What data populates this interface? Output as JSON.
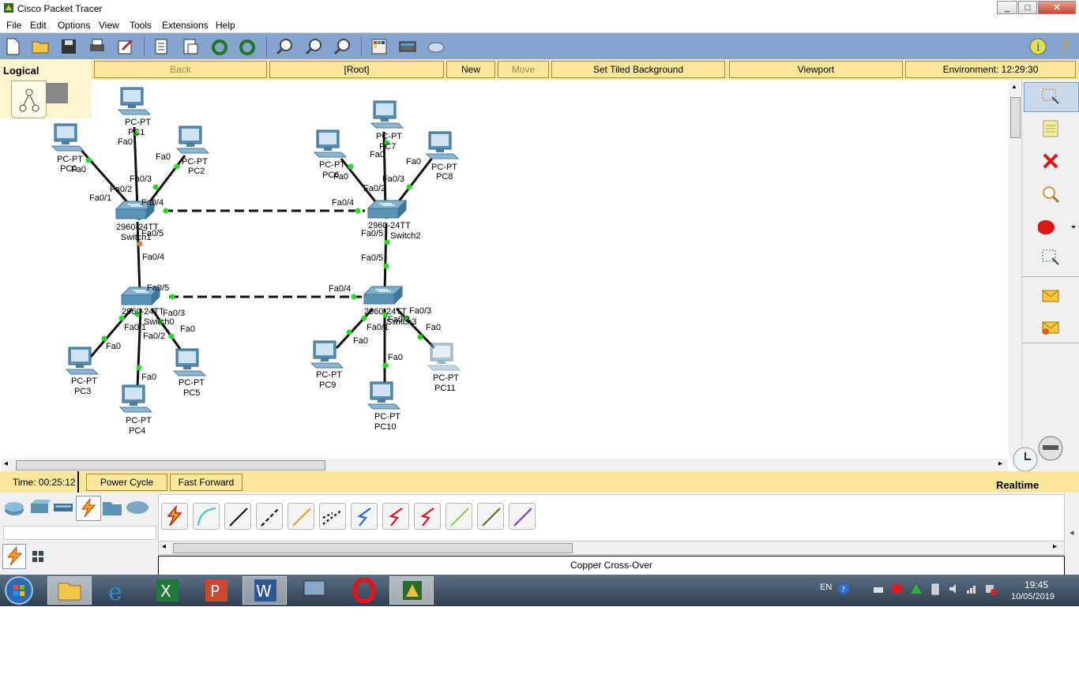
{
  "app": {
    "title": "Cisco Packet Tracer"
  },
  "menu": [
    "File",
    "Edit",
    "Options",
    "View",
    "Tools",
    "Extensions",
    "Help"
  ],
  "toolbar_icons": [
    "new-file-icon",
    "open-folder-icon",
    "save-icon",
    "print-icon",
    "activity-wizard-icon",
    "copy-icon",
    "paste-icon",
    "undo-icon",
    "redo-icon",
    "zoom-in-icon",
    "zoom-reset-icon",
    "zoom-out-icon",
    "palette-icon",
    "device-custom-icon",
    "cluster-icon",
    "info-icon",
    "help-icon"
  ],
  "nav": {
    "logical": "Logical",
    "back": "Back",
    "root": "[Root]",
    "new_cluster": "New Cluster",
    "move_object": "Move Object",
    "set_tiled_background": "Set Tiled Background",
    "viewport": "Viewport",
    "environment": "Environment: 12:29:30"
  },
  "topology": {
    "devices": [
      {
        "id": "pc1",
        "type": "PC-PT",
        "labels": [
          "PC-PT",
          "PC1"
        ]
      },
      {
        "id": "pc0",
        "type": "PC-PT",
        "labels": [
          "PC-PT",
          "PC0"
        ]
      },
      {
        "id": "pc2",
        "type": "PC-PT",
        "labels": [
          "PC-PT",
          "PC2"
        ]
      },
      {
        "id": "pc7",
        "type": "PC-PT",
        "labels": [
          "PC-PT",
          "PC7"
        ]
      },
      {
        "id": "pc6",
        "type": "PC-PT",
        "labels": [
          "PC-PT",
          "PC6"
        ]
      },
      {
        "id": "pc8",
        "type": "PC-PT",
        "labels": [
          "PC-PT",
          "PC8"
        ]
      },
      {
        "id": "sw1",
        "type": "switch",
        "labels": [
          "2960-24TT",
          "Switch1"
        ]
      },
      {
        "id": "sw2",
        "type": "switch",
        "labels": [
          "2960-24TT",
          "Switch2"
        ]
      },
      {
        "id": "sw0",
        "type": "switch",
        "labels": [
          "2960-24TT",
          "Switch0"
        ]
      },
      {
        "id": "sw3",
        "type": "switch",
        "labels": [
          "2960-24TT",
          "Switch3"
        ]
      },
      {
        "id": "pc3",
        "type": "PC-PT",
        "labels": [
          "PC-PT",
          "PC3"
        ]
      },
      {
        "id": "pc4",
        "type": "PC-PT",
        "labels": [
          "PC-PT",
          "PC4"
        ]
      },
      {
        "id": "pc5",
        "type": "PC-PT",
        "labels": [
          "PC-PT",
          "PC5"
        ]
      },
      {
        "id": "pc9",
        "type": "PC-PT",
        "labels": [
          "PC-PT",
          "PC9"
        ]
      },
      {
        "id": "pc10",
        "type": "PC-PT",
        "labels": [
          "PC-PT",
          "PC10"
        ]
      },
      {
        "id": "pc11",
        "type": "PC-PT",
        "labels": [
          "PC-PT",
          "PC11"
        ]
      }
    ],
    "port_labels": [
      "Fa0",
      "Fa0/3",
      "Fa0/2",
      "Fa0/1",
      "Fa0/4",
      "Fa0/5"
    ]
  },
  "right_tools": [
    "select-icon",
    "note-icon",
    "delete-icon",
    "inspect-icon",
    "draw-ellipse-icon",
    "resize-icon",
    "add-simple-pdu-icon",
    "add-complex-pdu-icon"
  ],
  "status": {
    "time": "Time: 00:25:12",
    "power_cycle": "Power Cycle Devices",
    "fast_forward": "Fast Forward Time",
    "mode": "Realtime"
  },
  "device_categories": [
    "routers-icon",
    "switches-icon",
    "hubs-icon",
    "connections-icon",
    "end-devices-icon",
    "wan-emulation-icon"
  ],
  "connections": [
    "automatic-connection",
    "console",
    "copper-straight-through",
    "copper-cross-over",
    "fiber",
    "phone",
    "coaxial",
    "serial-dce",
    "serial-dte",
    "octal",
    "iot-custom",
    "usb"
  ],
  "connection_selected_label": "Copper Cross-Over",
  "taskbar": {
    "apps": [
      "start-orb-icon",
      "explorer-icon",
      "internet-explorer-icon",
      "excel-icon",
      "powerpoint-icon",
      "word-icon",
      "remote-desktop-icon",
      "opera-icon",
      "packet-tracer-icon"
    ],
    "lang": "EN",
    "time": "19:45",
    "date": "10/05/2019"
  },
  "colors": {
    "toolbar": "#84a4cf",
    "nav_yellow": "#fbe79a",
    "link_green": "#22dd22",
    "taskbar": "#3c4e63"
  }
}
